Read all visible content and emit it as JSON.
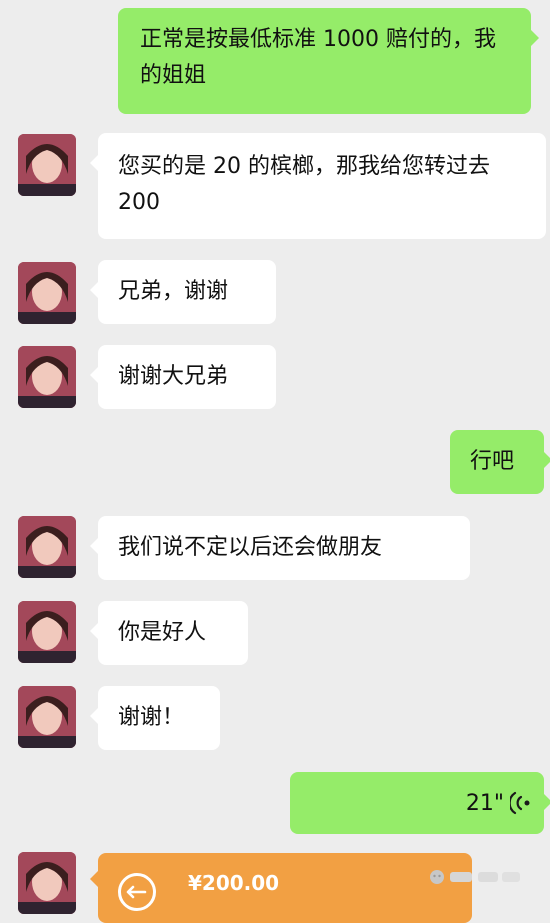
{
  "messages": [
    {
      "text": "正常是按最低标准 1000 赔付的，我的姐姐"
    },
    {
      "text": "您买的是 20 的槟榔，那我给您转过去 200"
    },
    {
      "text": "兄弟，谢谢"
    },
    {
      "text": "谢谢大兄弟"
    },
    {
      "text": "行吧"
    },
    {
      "text": "我们说不定以后还会做朋友"
    },
    {
      "text": "你是好人"
    },
    {
      "text": "谢谢！"
    }
  ],
  "voice_message": {
    "duration": "21\"",
    "icon": "voice-wave-icon"
  },
  "transfer": {
    "amount": "¥200.00",
    "icon": "transfer-arrow-icon"
  },
  "colors": {
    "background": "#ededed",
    "incoming_bubble": "#ffffff",
    "outgoing_bubble": "#95ec69",
    "transfer_card": "#f2a043"
  }
}
